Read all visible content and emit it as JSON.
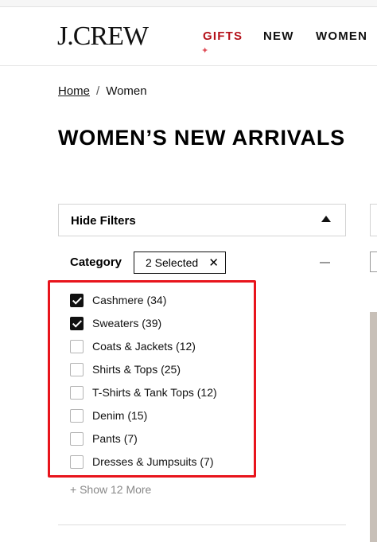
{
  "header": {
    "logo": "J.CREW",
    "nav": [
      "GIFTS",
      "NEW",
      "WOMEN"
    ],
    "gifts_accent": "#b5121b"
  },
  "breadcrumb": {
    "home": "Home",
    "separator": "/",
    "current": "Women"
  },
  "page_title": "WOMEN’S NEW ARRIVALS",
  "filters": {
    "toggle_label": "Hide Filters",
    "category_label": "Category",
    "selected_chip": "2 Selected",
    "chip_close": "✕",
    "items": [
      {
        "label": "Cashmere (34)",
        "checked": true
      },
      {
        "label": "Sweaters (39)",
        "checked": true
      },
      {
        "label": "Coats & Jackets (12)",
        "checked": false
      },
      {
        "label": "Shirts & Tops (25)",
        "checked": false
      },
      {
        "label": "T-Shirts & Tank Tops (12)",
        "checked": false
      },
      {
        "label": "Denim (15)",
        "checked": false
      },
      {
        "label": "Pants (7)",
        "checked": false
      },
      {
        "label": "Dresses & Jumpsuits (7)",
        "checked": false
      }
    ],
    "show_more": "+ Show 12 More"
  },
  "colors": {
    "highlight_border": "#e8141c"
  }
}
